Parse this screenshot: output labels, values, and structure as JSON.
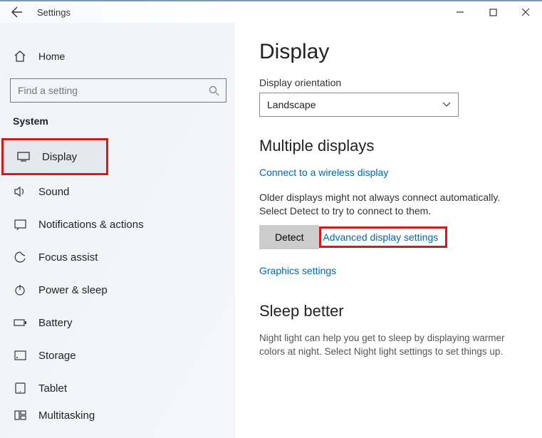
{
  "titlebar": {
    "title": "Settings"
  },
  "sidebar": {
    "home": "Home",
    "search_placeholder": "Find a setting",
    "section": "System",
    "items": [
      {
        "label": "Display"
      },
      {
        "label": "Sound"
      },
      {
        "label": "Notifications & actions"
      },
      {
        "label": "Focus assist"
      },
      {
        "label": "Power & sleep"
      },
      {
        "label": "Battery"
      },
      {
        "label": "Storage"
      },
      {
        "label": "Tablet"
      },
      {
        "label": "Multitasking"
      }
    ]
  },
  "main": {
    "title": "Display",
    "orientation_label": "Display orientation",
    "orientation_value": "Landscape",
    "multi_heading": "Multiple displays",
    "wireless_link": "Connect to a wireless display",
    "detect_text": "Older displays might not always connect automatically. Select Detect to try to connect to them.",
    "detect_btn": "Detect",
    "advanced_link": "Advanced display settings",
    "graphics_link": "Graphics settings",
    "sleep_heading": "Sleep better",
    "sleep_desc": "Night light can help you get to sleep by displaying warmer colors at night. Select Night light settings to set things up."
  }
}
